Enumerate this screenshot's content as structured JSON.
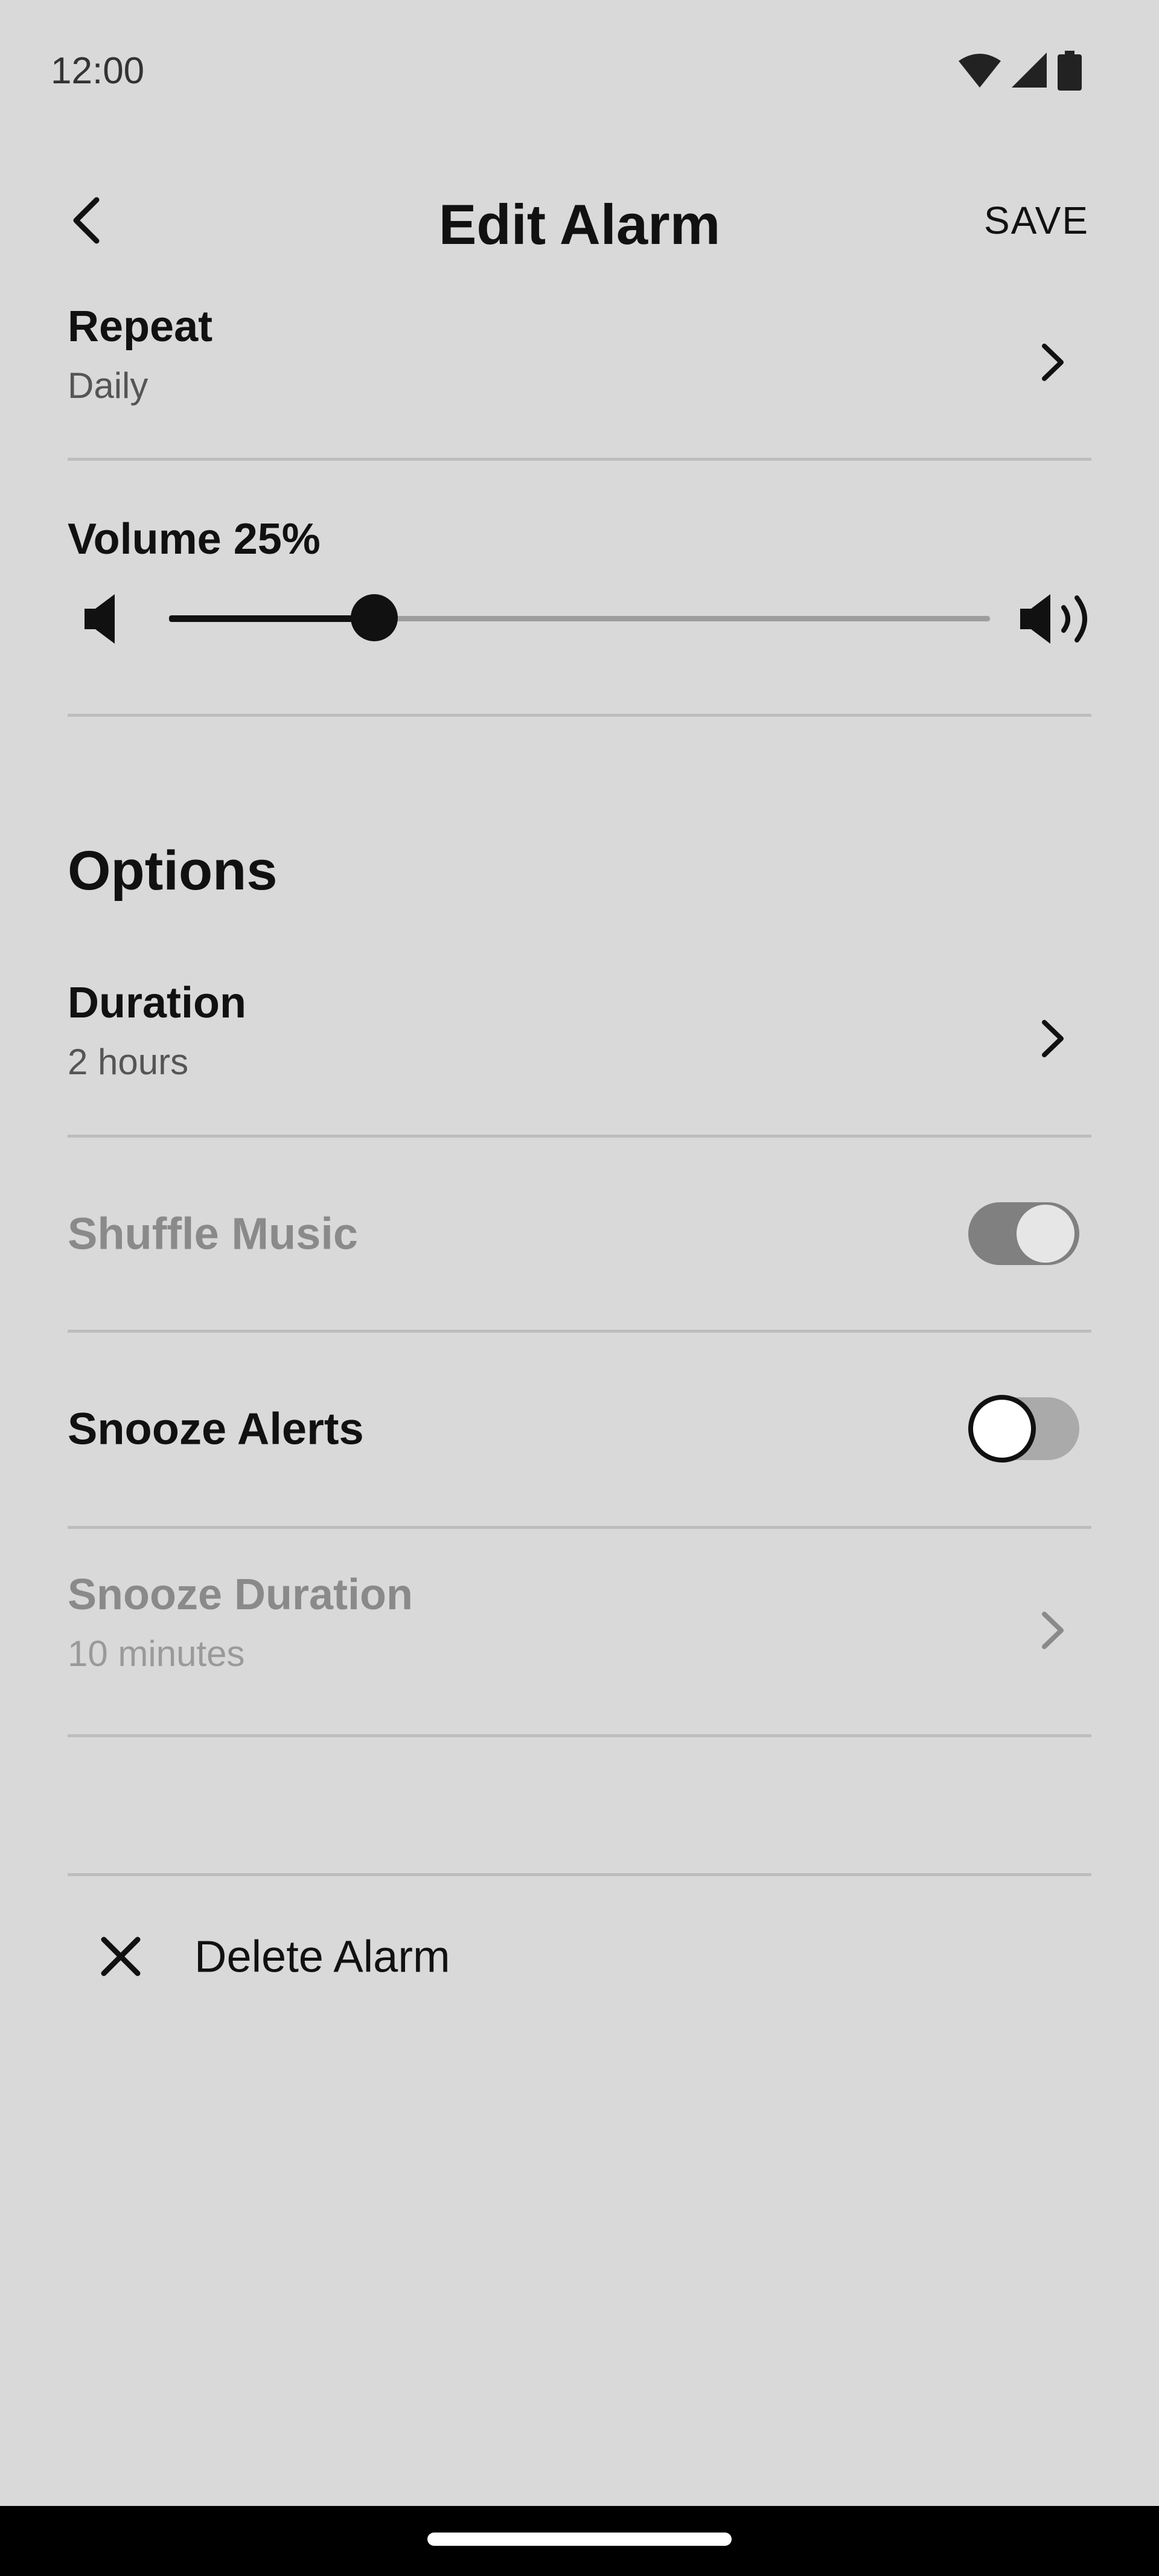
{
  "status_bar": {
    "time": "12:00",
    "icons": [
      "wifi-icon",
      "signal-icon",
      "battery-icon"
    ]
  },
  "app_bar": {
    "title": "Edit Alarm",
    "save_label": "SAVE",
    "back_icon": "chevron-left-icon"
  },
  "repeat": {
    "title": "Repeat",
    "value": "Daily"
  },
  "volume": {
    "label": "Volume 25%",
    "level": 0.25
  },
  "options": {
    "section_title": "Options",
    "duration": {
      "title": "Duration",
      "value": "2 hours"
    },
    "shuffle_music": {
      "label": "Shuffle Music",
      "enabled": false,
      "on": true
    },
    "snooze_alerts": {
      "label": "Snooze Alerts",
      "enabled": true,
      "on": false
    },
    "snooze_duration": {
      "title": "Snooze Duration",
      "value": "10 minutes",
      "enabled": false
    }
  },
  "delete": {
    "label": "Delete Alarm",
    "icon": "close-icon"
  },
  "colors": {
    "background": "#d9d9d9",
    "text": "#111111",
    "disabled_text": "#8a8a8a",
    "divider": "#bdbdbd"
  }
}
